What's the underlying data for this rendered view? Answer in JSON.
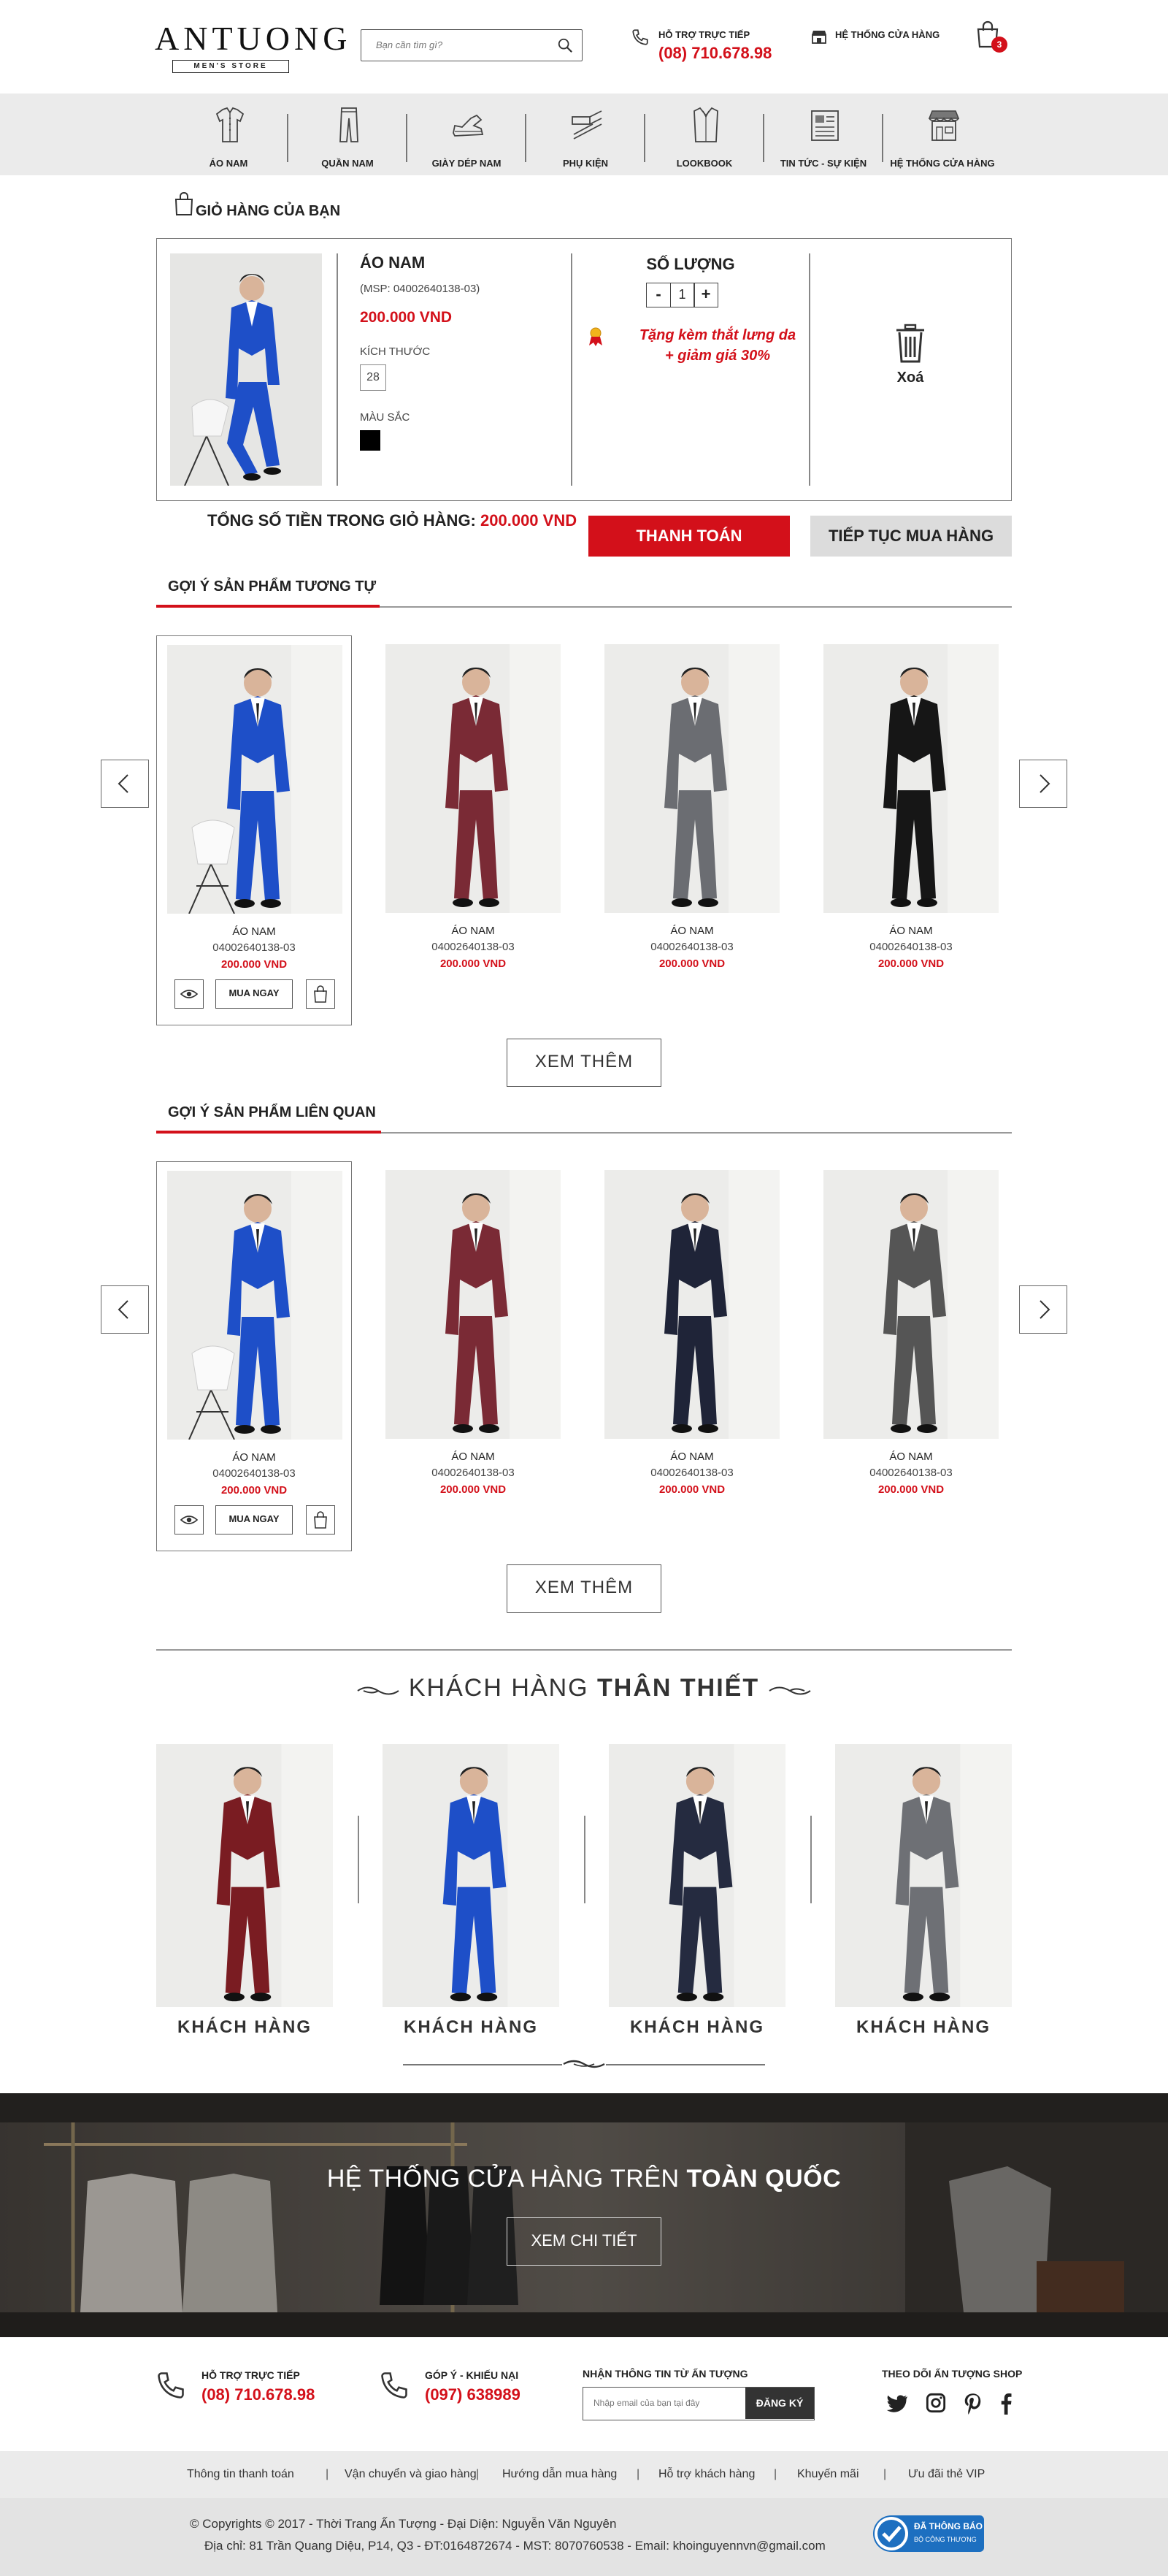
{
  "header": {
    "logo": "ANTUONG",
    "logo_sub": "MEN'S STORE",
    "search_placeholder": "Bạn cần tìm gì?",
    "hotline_label": "HỖ TRỢ TRỰC TIẾP",
    "hotline_number": "(08) 710.678.98",
    "stores_label": "HỆ THỐNG CỬA HÀNG",
    "cart_count": "3"
  },
  "nav": [
    {
      "label": "ÁO NAM",
      "icon": "shirt-icon"
    },
    {
      "label": "QUẦN NAM",
      "icon": "pants-icon"
    },
    {
      "label": "GIÀY DÉP NAM",
      "icon": "shoe-icon"
    },
    {
      "label": "PHỤ KIỆN",
      "icon": "belt-icon"
    },
    {
      "label": "LOOKBOOK",
      "icon": "suit-icon"
    },
    {
      "label": "TIN TỨC - SỰ KIỆN",
      "icon": "newspaper-icon"
    },
    {
      "label": "HỆ THỐNG CỬA HÀNG",
      "icon": "storefront-icon"
    }
  ],
  "cart": {
    "title": "GIỎ HÀNG CỦA BẠN",
    "item": {
      "name": "ÁO NAM",
      "sku": "(MSP: 04002640138-03)",
      "price": "200.000 VND",
      "size_label": "KÍCH THƯỚC",
      "size": "28",
      "color_label": "MÀU SẮC",
      "color": "#000000",
      "suit_color": "#1e4fc8"
    },
    "qty_label": "SỐ LƯỢNG",
    "qty_minus": "-",
    "qty_value": "1",
    "qty_plus": "+",
    "promo_line1": "Tặng kèm thắt lưng da",
    "promo_line2": "+ giảm giá 30%",
    "delete_label": "Xoá",
    "total_label": "TỔNG SỐ TIỀN TRONG GIỎ HÀNG:",
    "total_value": "200.000 VND",
    "checkout": "THANH TOÁN",
    "continue": "TIẾP TỤC MUA HÀNG"
  },
  "similar": {
    "title": "GỢI Ý SẢN PHẨM TƯƠNG TỰ",
    "more": "XEM THÊM",
    "buy_now": "MUA NGAY",
    "products": [
      {
        "name": "ÁO NAM",
        "code": "04002640138-03",
        "price": "200.000 VND",
        "color": "#1e4fc8"
      },
      {
        "name": "ÁO NAM",
        "code": "04002640138-03",
        "price": "200.000 VND",
        "color": "#7a2a35"
      },
      {
        "name": "ÁO NAM",
        "code": "04002640138-03",
        "price": "200.000 VND",
        "color": "#6b6d72"
      },
      {
        "name": "ÁO NAM",
        "code": "04002640138-03",
        "price": "200.000 VND",
        "color": "#161616"
      }
    ]
  },
  "related": {
    "title": "GỢI Ý SẢN PHẨM LIÊN QUAN",
    "more": "XEM THÊM",
    "buy_now": "MUA NGAY",
    "products": [
      {
        "name": "ÁO NAM",
        "code": "04002640138-03",
        "price": "200.000 VND",
        "color": "#1e4fc8"
      },
      {
        "name": "ÁO NAM",
        "code": "04002640138-03",
        "price": "200.000 VND",
        "color": "#7a2a35"
      },
      {
        "name": "ÁO NAM",
        "code": "04002640138-03",
        "price": "200.000 VND",
        "color": "#1f2438"
      },
      {
        "name": "ÁO NAM",
        "code": "04002640138-03",
        "price": "200.000 VND",
        "color": "#555555"
      }
    ]
  },
  "customers": {
    "title_light": "KHÁCH HÀNG",
    "title_bold": "THÂN THIẾT",
    "items": [
      {
        "name": "KHÁCH HÀNG",
        "color": "#7a1c22"
      },
      {
        "name": "KHÁCH HÀNG",
        "color": "#1e4fc8"
      },
      {
        "name": "KHÁCH HÀNG",
        "color": "#252b40"
      },
      {
        "name": "KHÁCH HÀNG",
        "color": "#6e7075"
      }
    ]
  },
  "banner": {
    "title_light": "HỆ THỐNG CỬA HÀNG TRÊN",
    "title_bold": "TOÀN QUỐC",
    "button": "XEM CHI TIẾT"
  },
  "footer": {
    "support_label": "HỖ TRỢ TRỰC TIẾP",
    "support_number": "(08) 710.678.98",
    "feedback_label": "GÓP Ý - KHIẾU NẠI",
    "feedback_number": "(097) 638989",
    "newsletter_label": "NHẬN THÔNG TIN TỪ ẤN TƯỢNG",
    "newsletter_placeholder": "Nhập email của bạn tại đây",
    "newsletter_button": "ĐĂNG KÝ",
    "social_label": "THEO DÕI ẤN TƯỢNG SHOP",
    "links": [
      "Thông tin thanh toán",
      "Vận chuyển và giao hàng",
      "Hướng dẫn mua hàng",
      "Hỗ trợ khách hàng",
      "Khuyến mãi",
      "Ưu đãi thẻ VIP"
    ],
    "copyright": "© Copyrights © 2017 - Thời Trang Ấn Tượng - Đại Diện: Nguyễn Văn Nguyên",
    "address": "Địa chỉ: 81 Trần Quang Diệu, P14, Q3 - ĐT:0164872674 - MST: 8070760538 - Email: khoinguyennvn@gmail.com",
    "badge_line1": "ĐÃ THÔNG BÁO",
    "badge_line2": "BỘ CÔNG THƯƠNG"
  }
}
